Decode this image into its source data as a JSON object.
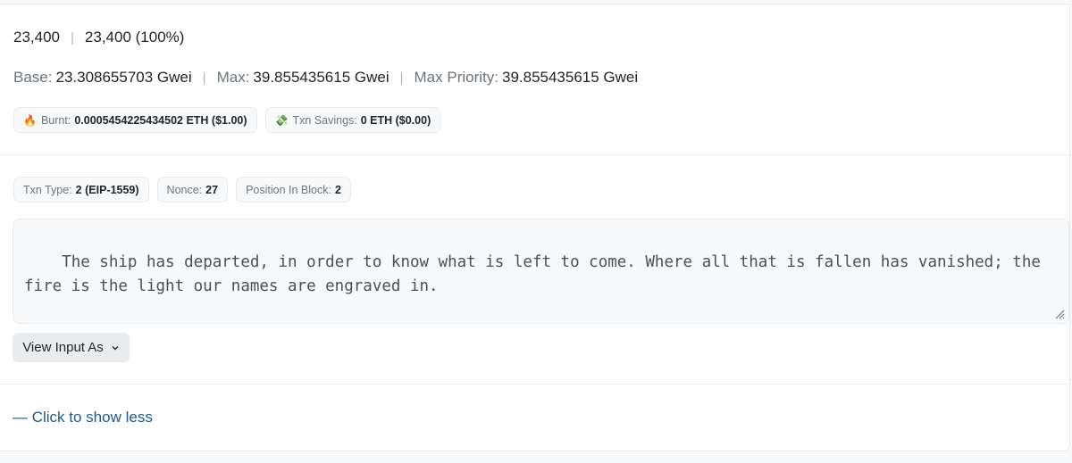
{
  "gas": {
    "limit": "23,400",
    "used": "23,400 (100%)"
  },
  "fees": {
    "base_label": "Base:",
    "base_value": "23.308655703 Gwei",
    "max_label": "Max:",
    "max_value": "39.855435615 Gwei",
    "max_priority_label": "Max Priority:",
    "max_priority_value": "39.855435615 Gwei"
  },
  "burnt": {
    "icon": "fire-icon",
    "emoji": "🔥",
    "label": "Burnt:",
    "value": "0.0005454225434502 ETH ($1.00)"
  },
  "savings": {
    "icon": "money-icon",
    "emoji": "💸",
    "label": "Txn Savings:",
    "value": "0 ETH ($0.00)"
  },
  "attributes": {
    "txn_type_label": "Txn Type:",
    "txn_type_value": "2 (EIP-1559)",
    "nonce_label": "Nonce:",
    "nonce_value": "27",
    "position_label": "Position In Block:",
    "position_value": "2"
  },
  "input_data": {
    "text": "The ship has departed, in order to know what is left to come. Where all that is fallen has vanished; the fire is the light our names are engraved in."
  },
  "view_input": {
    "label": "View Input As",
    "icon": "chevron-down-icon"
  },
  "toggle": {
    "label": "— Click to show less"
  },
  "colors": {
    "link": "#1e5a8c",
    "muted": "#6c757d",
    "pill_bg": "#f8f9fa",
    "border": "#e9ecef"
  }
}
